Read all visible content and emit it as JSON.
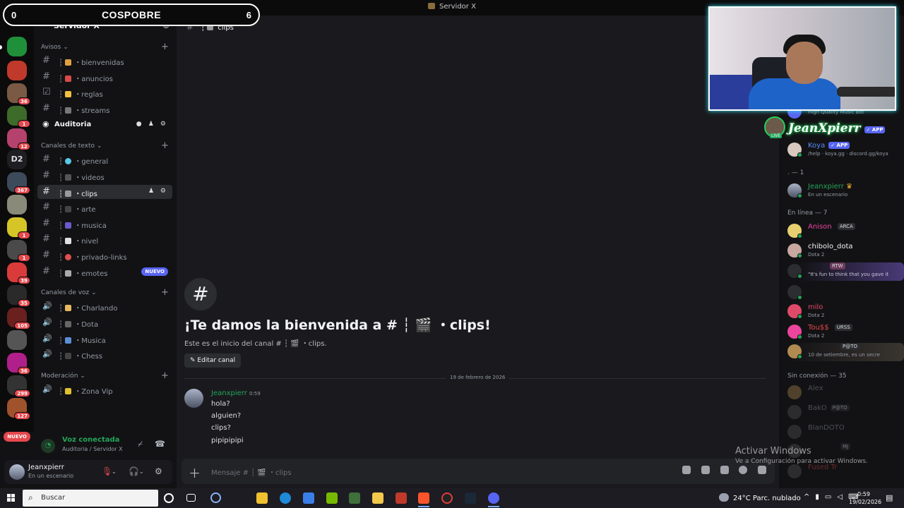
{
  "window": {
    "title": "Servidor X"
  },
  "overlay": {
    "score_left": "0",
    "score_right": "6",
    "score_title": "COSPOBRE",
    "streamer_name": "JeanXpierr",
    "live": "LIVE"
  },
  "rail": {
    "badges": [
      "36",
      "1",
      "12",
      "367",
      "1",
      "1",
      "39",
      "35",
      "105",
      "36",
      "299",
      "127"
    ],
    "text_server": "D2",
    "nuevo": "NUEVO"
  },
  "sidebar": {
    "server_name": "Servidor X",
    "categories": {
      "avisos": "Avisos",
      "texto": "Canales de texto",
      "voz": "Canales de voz",
      "moderacion": "Moderación"
    },
    "channels": {
      "bienvenidas": "bienvenidas",
      "anuncios": "anuncios",
      "reglas": "reglas",
      "streams": "streams",
      "auditoria": "Auditoria",
      "general": "general",
      "videos": "videos",
      "clips": "clips",
      "arte": "arte",
      "musica": "musica",
      "nivel": "nivel",
      "privado": "privado-links",
      "emotes": "emotes",
      "emotes_badge": "NUEVO",
      "charlando": "Charlando",
      "dota": "Dota",
      "musica_voz": "Musica",
      "chess": "Chess",
      "zona_vip": "Zona Vip"
    }
  },
  "voice_panel": {
    "status": "Voz conectada",
    "location": "Auditoria / Servidor X"
  },
  "user": {
    "name": "Jeanxpierr",
    "status": "En un escenario"
  },
  "chat": {
    "header_channel": "clips",
    "welcome": "¡Te damos la bienvenida a # ┆ 🎬 ・clips!",
    "welcome_sub": "Este es el inicio del canal # ┆ 🎬 ・clips.",
    "edit_button": "Editar canal",
    "date_divider": "19 de febrero de 2026",
    "message": {
      "author": "Jeanxpierr",
      "time": "0:59",
      "lines": [
        "hola?",
        "alguien?",
        "clips?",
        "pipipipipi"
      ]
    },
    "composer_placeholder": "Mensaje # ┆ 🎬 ・clips"
  },
  "members": {
    "bot_top_sub": "High Quality Music Bot",
    "koya": {
      "name": "Koya",
      "tag": "✓ APP",
      "sub": "/help · koya.gg · discord.gg/koya"
    },
    "jeanx_tag": "✓ APP",
    "group_owner": ". — 1",
    "owner": {
      "name": "Jeanxpierr",
      "sub": "En un escenario"
    },
    "group_online": "En línea — 7",
    "online": [
      {
        "name": "Anison",
        "tag": "ARCA",
        "sub": ""
      },
      {
        "name": "chibolo_dota",
        "tag": "",
        "sub": "Dota 2"
      },
      {
        "name": "",
        "tag": "RTW",
        "sub": "\"It's fun to think that you gave it"
      },
      {
        "name": "",
        "tag": "",
        "sub": ""
      },
      {
        "name": "milo",
        "tag": "",
        "sub": "Dota 2"
      },
      {
        "name": "Tou$$",
        "tag": "URSS",
        "sub": "Dota 2"
      },
      {
        "name": "",
        "tag": "P@TO",
        "sub": "10 de setiembre, es un secre"
      }
    ],
    "group_offline": "Sin conexión — 35",
    "offline": [
      {
        "name": "Alex",
        "tag": ""
      },
      {
        "name": "BakO",
        "tag": "P@TO"
      },
      {
        "name": "BlanDOTO",
        "tag": ""
      },
      {
        "name": "",
        "tag": "MJ"
      },
      {
        "name": "Fused Tr",
        "tag": ""
      }
    ]
  },
  "watermark": {
    "line1": "Activar Windows",
    "line2": "Ve a Configuración para activar Windows."
  },
  "taskbar": {
    "search": "Buscar",
    "weather": "24°C  Parc. nublado",
    "time": "0:59",
    "date": "19/02/2026"
  }
}
